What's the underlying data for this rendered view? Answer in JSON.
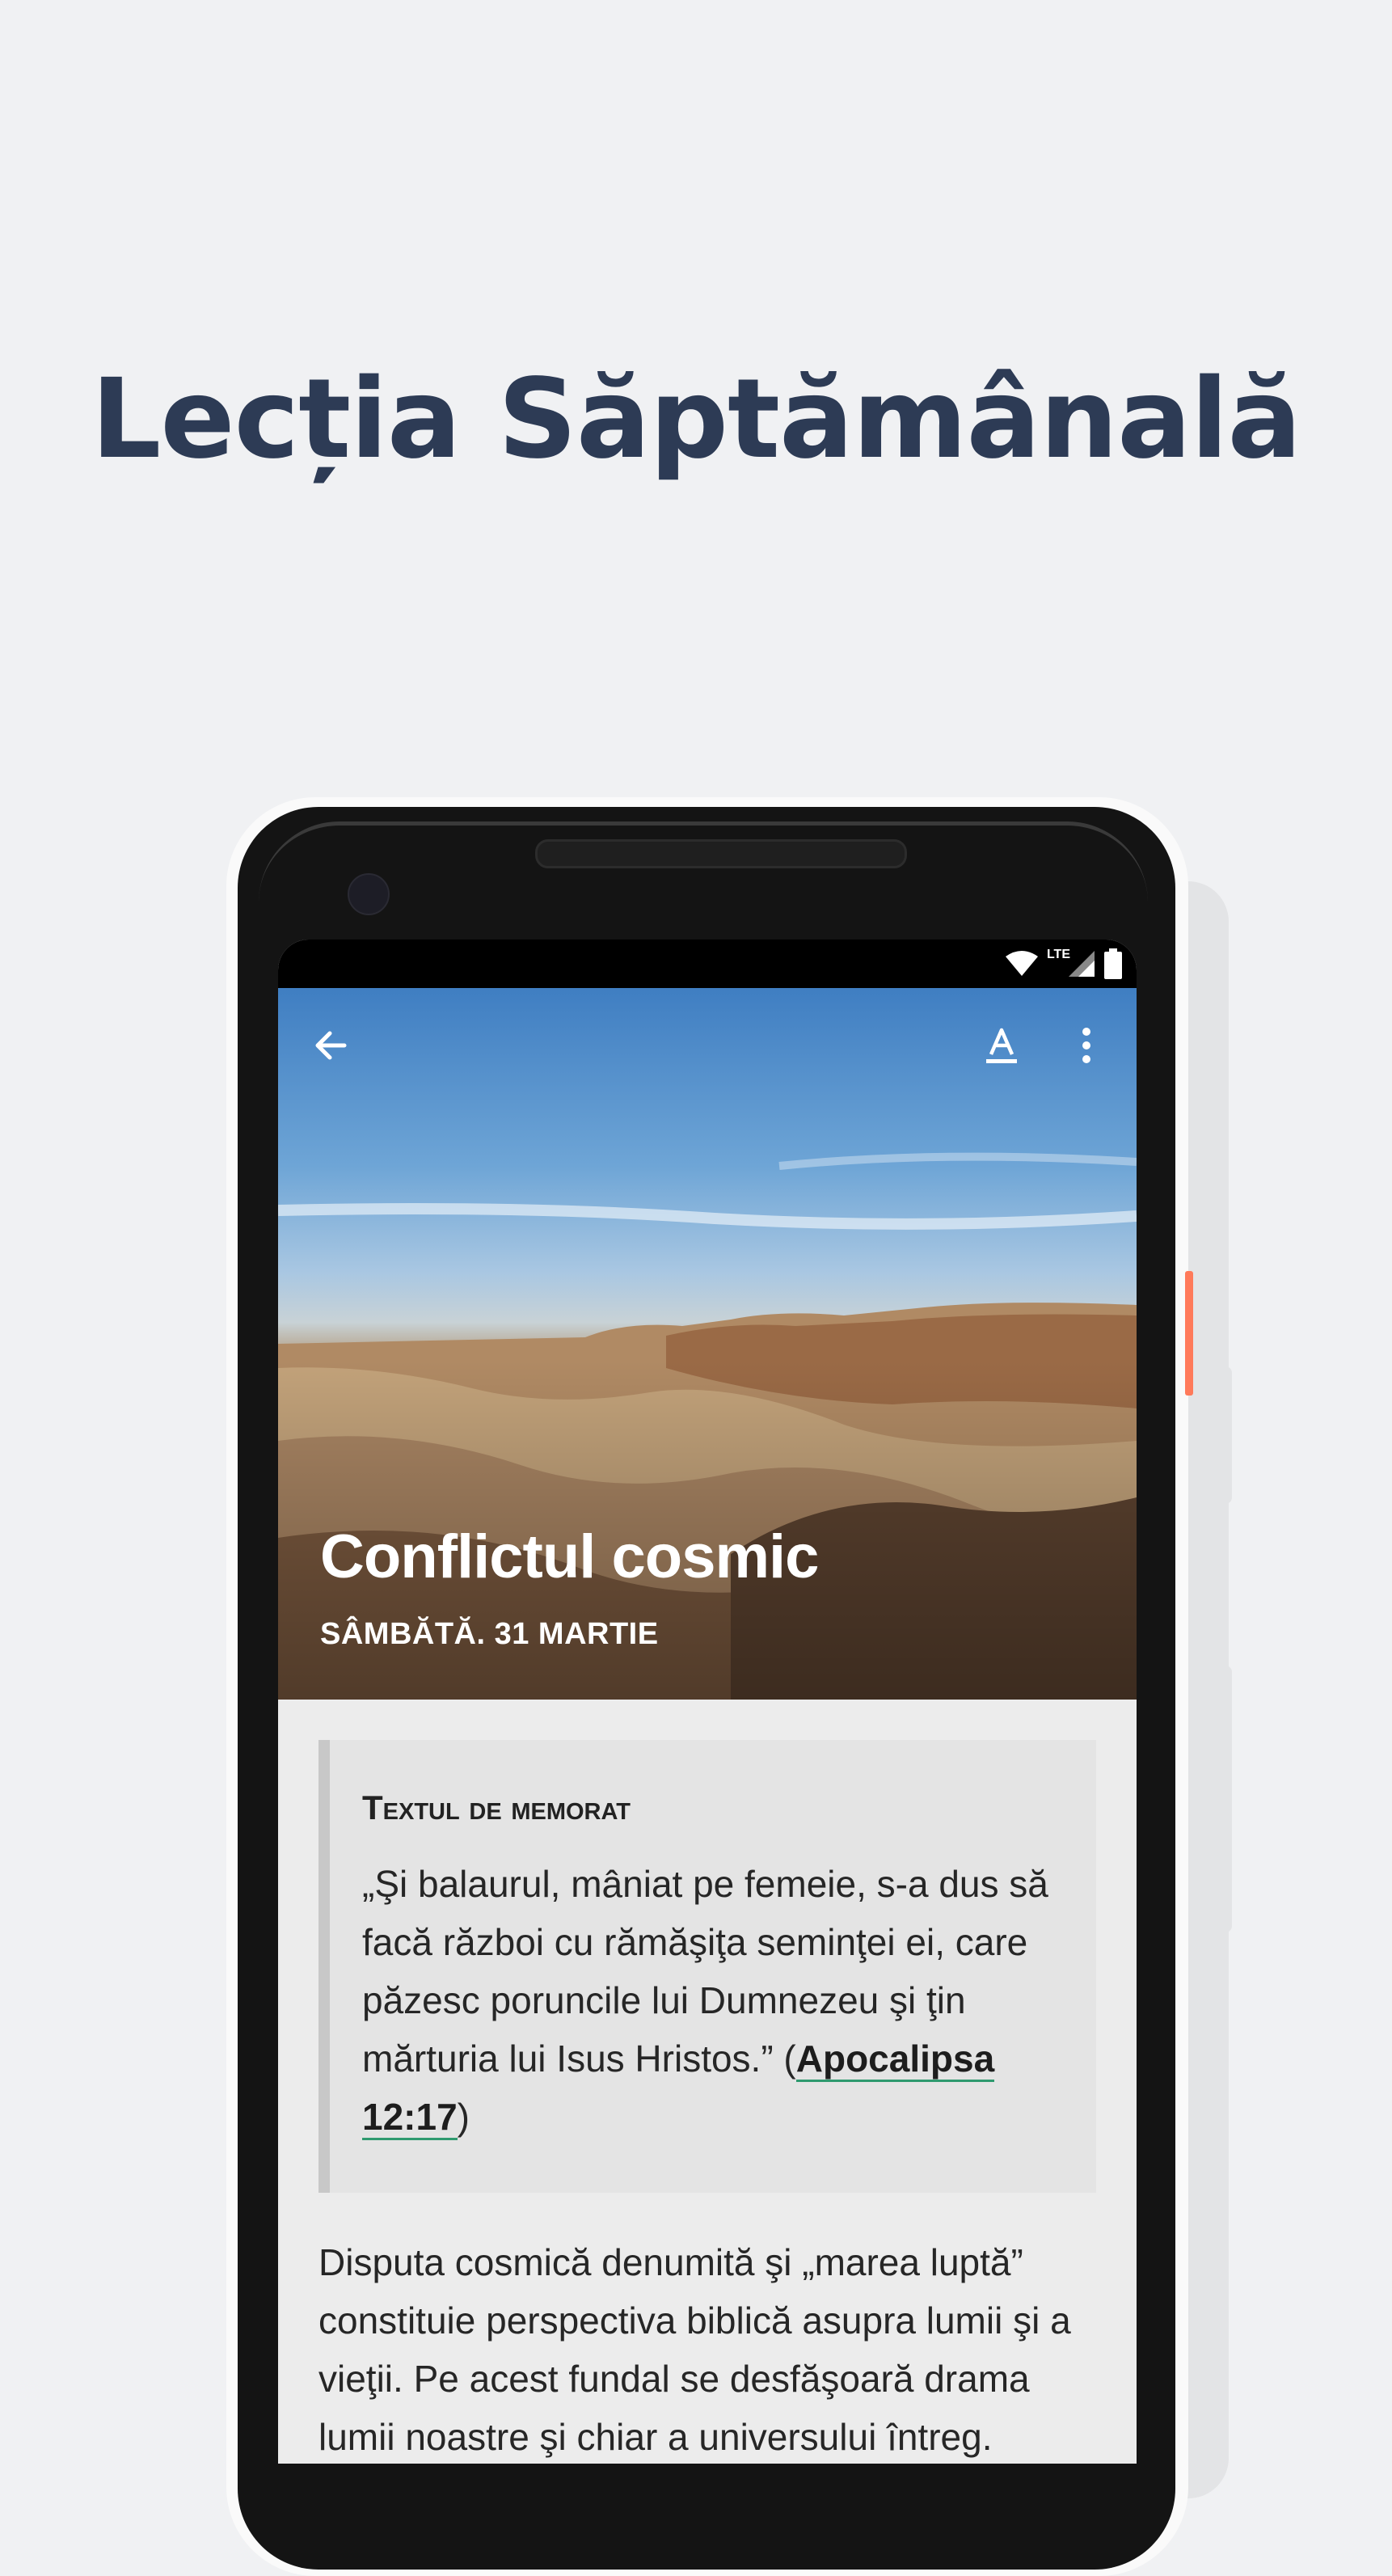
{
  "promo": {
    "title": "Lecția Săptămânală"
  },
  "status_bar": {
    "network": "LTE"
  },
  "toolbar": {
    "back_icon": "arrow-left-icon",
    "font_icon": "text-format-icon",
    "more_icon": "more-vertical-icon"
  },
  "lesson": {
    "title": "Conflictul cosmic",
    "date": "SÂMBĂTĂ. 31 MARTIE"
  },
  "memory_verse": {
    "heading": "Textul de memorat",
    "text": "„Şi balaurul, mâniat pe femeie, s-a dus să facă război cu rămăşiţa seminţei ei, care păzesc poruncile lui Dumnezeu şi ţin mărturia lui Isus Hristos.” (",
    "reference": "Apocalipsa 12:17",
    "closing": ")"
  },
  "body": {
    "paragraph": "Disputa cosmică denumită şi „marea luptă” constituie perspectiva biblică asupra lumii şi a vieţii. Pe acest fundal se desfăşoară drama lumii noastre şi chiar a universului întreg."
  },
  "colors": {
    "page_bg": "#f0f1f3",
    "title": "#2d3b55",
    "link_underline": "#2f9a6f",
    "phone_accent": "#ff7a5a"
  }
}
